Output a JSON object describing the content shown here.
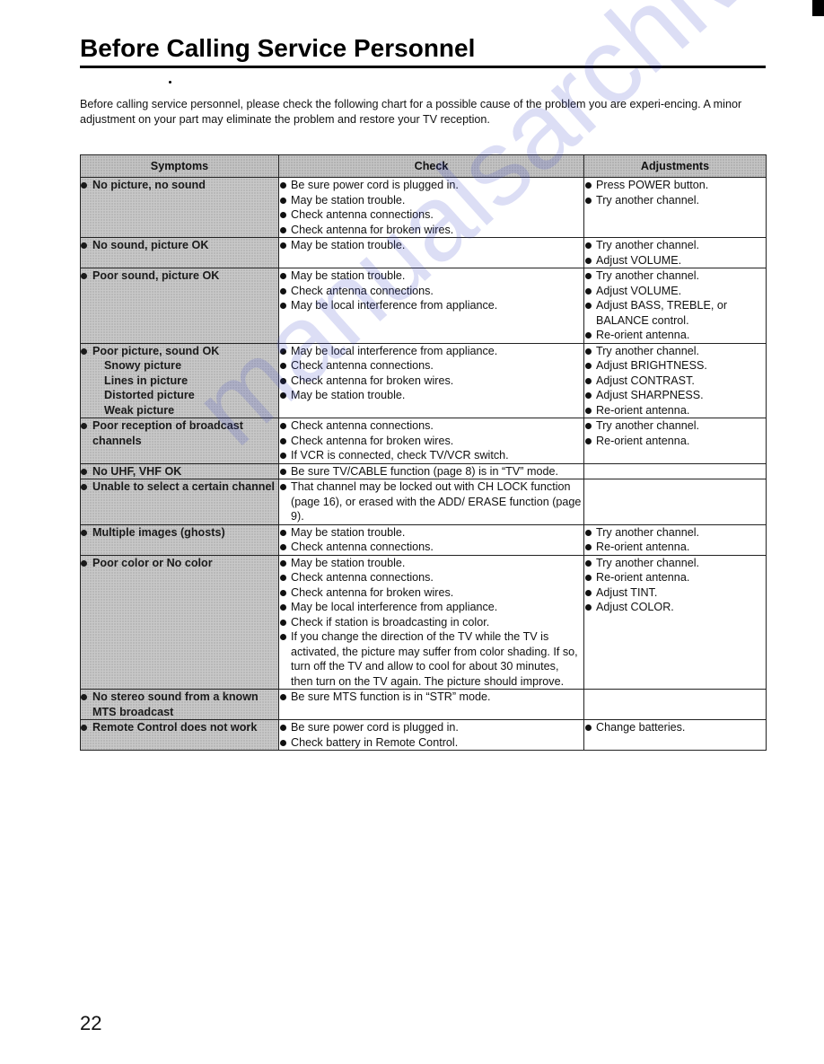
{
  "page": {
    "title": "Before Calling Service Personnel",
    "intro": "Before calling service personnel, please check the following chart for a possible cause of the problem you are experi-encing. A minor adjustment on your part may eliminate the problem and restore your TV reception.",
    "page_number": "22",
    "watermark": "manualsarchive.com"
  },
  "table": {
    "headers": {
      "symptoms": "Symptoms",
      "check": "Check",
      "adjustments": "Adjustments"
    },
    "rows": [
      {
        "symptom": "No picture, no sound",
        "sub": [],
        "check": [
          "Be sure power cord is plugged in.",
          "May be station trouble.",
          "Check antenna connections.",
          "Check antenna for broken wires."
        ],
        "adjust": [
          "Press POWER button.",
          "Try another channel."
        ]
      },
      {
        "symptom": "No sound, picture OK",
        "sub": [],
        "check": [
          "May be station trouble."
        ],
        "adjust": [
          "Try another channel.",
          "Adjust VOLUME."
        ]
      },
      {
        "symptom": "Poor sound, picture OK",
        "sub": [],
        "check": [
          "May be station trouble.",
          "Check antenna connections.",
          "May be local interference from appliance."
        ],
        "adjust": [
          "Try another channel.",
          "Adjust VOLUME.",
          "Adjust BASS, TREBLE, or BALANCE control.",
          "Re-orient antenna."
        ]
      },
      {
        "symptom": "Poor picture, sound OK",
        "sub": [
          "Snowy picture",
          "Lines in picture",
          "Distorted picture",
          "Weak picture"
        ],
        "check": [
          "May be local interference from appliance.",
          "Check antenna connections.",
          "Check antenna for broken wires.",
          "May be station trouble."
        ],
        "adjust": [
          "Try another channel.",
          "Adjust BRIGHTNESS.",
          "Adjust CONTRAST.",
          "Adjust SHARPNESS.",
          "Re-orient antenna."
        ]
      },
      {
        "symptom": "Poor reception of broadcast channels",
        "sub": [],
        "check": [
          "Check antenna connections.",
          "Check antenna for broken wires.",
          "If VCR is connected, check TV/VCR switch."
        ],
        "adjust": [
          "Try another channel.",
          "Re-orient antenna."
        ]
      },
      {
        "symptom": "No UHF, VHF OK",
        "sub": [],
        "check": [
          "Be sure TV/CABLE function (page 8) is in “TV” mode."
        ],
        "adjust": []
      },
      {
        "symptom": "Unable to select a certain channel",
        "sub": [],
        "check": [
          "That channel may be locked out with CH LOCK function (page 16), or erased with the ADD/ ERASE function (page 9)."
        ],
        "adjust": []
      },
      {
        "symptom": "Multiple images (ghosts)",
        "sub": [],
        "check": [
          "May be station trouble.",
          "Check antenna connections."
        ],
        "adjust": [
          "Try another channel.",
          "Re-orient antenna."
        ]
      },
      {
        "symptom": "Poor color or No color",
        "sub": [],
        "check": [
          "May be station trouble.",
          "Check antenna connections.",
          "Check antenna for broken wires.",
          "May be local interference from appliance.",
          "Check if station is broadcasting in color.",
          "If you change the direction of the TV while the TV is activated, the picture may suffer from color shading. If so, turn off the TV and allow to cool for about 30 minutes, then turn on the TV again. The picture should improve."
        ],
        "adjust": [
          "Try another channel.",
          "Re-orient antenna.",
          "Adjust TINT.",
          "Adjust COLOR."
        ]
      },
      {
        "symptom": "No stereo sound from a known MTS broadcast",
        "sub": [],
        "check": [
          "Be sure MTS function is in “STR” mode."
        ],
        "adjust": []
      },
      {
        "symptom": "Remote Control does not work",
        "sub": [],
        "check": [
          "Be sure power cord is plugged in.",
          "Check battery in Remote Control."
        ],
        "adjust": [
          "Change batteries."
        ]
      }
    ]
  }
}
